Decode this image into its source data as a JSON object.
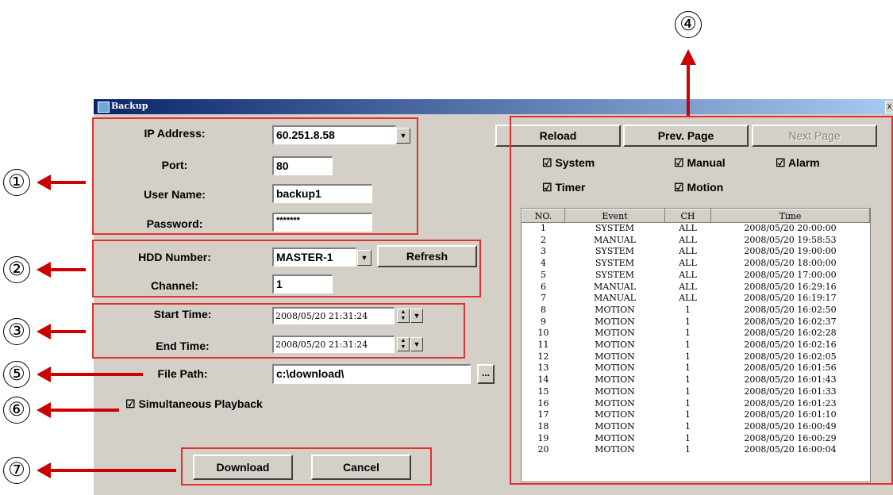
{
  "window": {
    "title": "Backup",
    "close_glyph": "x"
  },
  "form": {
    "ip_label": "IP Address:",
    "ip_value": "60.251.8.58",
    "port_label": "Port:",
    "port_value": "80",
    "user_label": "User Name:",
    "user_value": "backup1",
    "password_label": "Password:",
    "password_value": "*******",
    "hdd_label": "HDD Number:",
    "hdd_value": "MASTER-1",
    "refresh_label": "Refresh",
    "channel_label": "Channel:",
    "channel_value": "1",
    "start_label": "Start Time:",
    "start_value": "2008/05/20 21:31:24",
    "end_label": "End Time:",
    "end_value": "2008/05/20 21:31:24",
    "filepath_label": "File Path:",
    "filepath_value": "c:\\download\\",
    "browse_label": "...",
    "simultaneous_label": "Simultaneous Playback",
    "download_label": "Download",
    "cancel_label": "Cancel"
  },
  "event_panel": {
    "reload_label": "Reload",
    "prev_label": "Prev. Page",
    "next_label": "Next Page",
    "filters": {
      "system": "System",
      "manual": "Manual",
      "alarm": "Alarm",
      "timer": "Timer",
      "motion": "Motion"
    },
    "columns": [
      "NO.",
      "Event",
      "CH",
      "Time"
    ],
    "rows": [
      [
        "1",
        "SYSTEM",
        "ALL",
        "2008/05/20 20:00:00"
      ],
      [
        "2",
        "MANUAL",
        "ALL",
        "2008/05/20 19:58:53"
      ],
      [
        "3",
        "SYSTEM",
        "ALL",
        "2008/05/20 19:00:00"
      ],
      [
        "4",
        "SYSTEM",
        "ALL",
        "2008/05/20 18:00:00"
      ],
      [
        "5",
        "SYSTEM",
        "ALL",
        "2008/05/20 17:00:00"
      ],
      [
        "6",
        "MANUAL",
        "ALL",
        "2008/05/20 16:29:16"
      ],
      [
        "7",
        "MANUAL",
        "ALL",
        "2008/05/20 16:19:17"
      ],
      [
        "8",
        "MOTION",
        "1",
        "2008/05/20 16:02:50"
      ],
      [
        "9",
        "MOTION",
        "1",
        "2008/05/20 16:02:37"
      ],
      [
        "10",
        "MOTION",
        "1",
        "2008/05/20 16:02:28"
      ],
      [
        "11",
        "MOTION",
        "1",
        "2008/05/20 16:02:16"
      ],
      [
        "12",
        "MOTION",
        "1",
        "2008/05/20 16:02:05"
      ],
      [
        "13",
        "MOTION",
        "1",
        "2008/05/20 16:01:56"
      ],
      [
        "14",
        "MOTION",
        "1",
        "2008/05/20 16:01:43"
      ],
      [
        "15",
        "MOTION",
        "1",
        "2008/05/20 16:01:33"
      ],
      [
        "16",
        "MOTION",
        "1",
        "2008/05/20 16:01:23"
      ],
      [
        "17",
        "MOTION",
        "1",
        "2008/05/20 16:01:10"
      ],
      [
        "18",
        "MOTION",
        "1",
        "2008/05/20 16:00:49"
      ],
      [
        "19",
        "MOTION",
        "1",
        "2008/05/20 16:00:29"
      ],
      [
        "20",
        "MOTION",
        "1",
        "2008/05/20 16:00:04"
      ]
    ]
  },
  "annotations": {
    "c1": "①",
    "c2": "②",
    "c3": "③",
    "c4": "④",
    "c5": "⑤",
    "c6": "⑥",
    "c7": "⑦"
  },
  "colors": {
    "highlight": "#e03030",
    "arrow": "#cc0000",
    "titlebar": "#0a246a"
  },
  "icons": {
    "checkbox_checked": "checkbox-checked-icon",
    "dropdown": "chevron-down-icon",
    "spin": "spin-updown-icon"
  }
}
